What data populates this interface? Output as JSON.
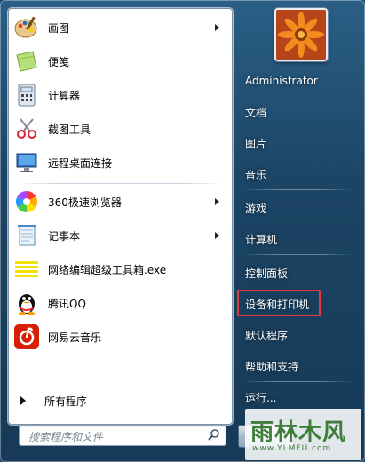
{
  "programs": [
    {
      "label": "画图",
      "icon": "paint-icon",
      "has_submenu": true
    },
    {
      "label": "便笺",
      "icon": "sticky-notes-icon",
      "has_submenu": false
    },
    {
      "label": "计算器",
      "icon": "calculator-icon",
      "has_submenu": false
    },
    {
      "label": "截图工具",
      "icon": "snipping-tool-icon",
      "has_submenu": false
    },
    {
      "label": "远程桌面连接",
      "icon": "remote-desktop-icon",
      "has_submenu": false
    },
    {
      "label": "360极速浏览器",
      "icon": "browser-360-icon",
      "has_submenu": true
    },
    {
      "label": "记事本",
      "icon": "notepad-icon",
      "has_submenu": true
    },
    {
      "label": "网络编辑超级工具箱.exe",
      "icon": "toolbox-exe-icon",
      "has_submenu": false
    },
    {
      "label": "腾讯QQ",
      "icon": "qq-penguin-icon",
      "has_submenu": false
    },
    {
      "label": "网易云音乐",
      "icon": "netease-music-icon",
      "has_submenu": false
    }
  ],
  "all_programs_label": "所有程序",
  "search": {
    "placeholder": "搜索程序和文件"
  },
  "right_menu": [
    {
      "label": "Administrator"
    },
    {
      "label": "文档"
    },
    {
      "label": "图片"
    },
    {
      "label": "音乐"
    },
    {
      "label": "游戏"
    },
    {
      "label": "计算机"
    },
    {
      "label": "控制面板"
    },
    {
      "label": "设备和打印机",
      "highlighted": true
    },
    {
      "label": "默认程序"
    },
    {
      "label": "帮助和支持"
    },
    {
      "label": "运行..."
    }
  ],
  "watermark": {
    "big": "雨林木风",
    "small": "www.YLMFU.com"
  },
  "colors": {
    "highlight_border": "#e23b3b",
    "panel_bg": "#1c4464",
    "watermark_text": "#3e7d3a"
  }
}
